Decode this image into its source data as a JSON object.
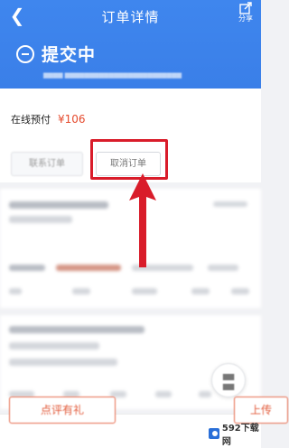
{
  "header": {
    "title": "订单详情",
    "share_label": "分享",
    "status": "提交中"
  },
  "payment": {
    "label": "在线预付",
    "amount": "¥106"
  },
  "actions": {
    "contact_label": "联系订单",
    "cancel_label": "取消订单"
  },
  "bottom": {
    "left_label": "点评有礼",
    "right_label": "上传"
  },
  "watermark": {
    "text": "592下载网"
  },
  "colors": {
    "header_blue": "#3f86ee",
    "price_red": "#e54a2d",
    "highlight_red": "#d91c2a"
  }
}
